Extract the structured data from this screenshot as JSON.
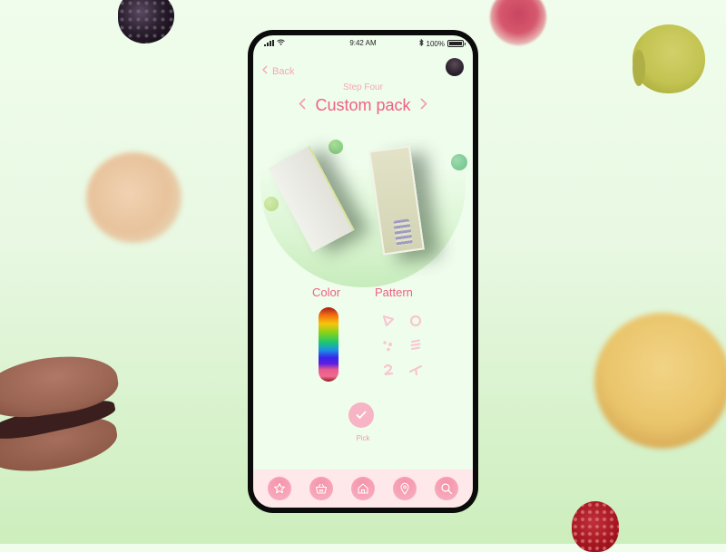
{
  "status_bar": {
    "time": "9:42 AM",
    "battery": "100%",
    "icons": [
      "signal-icon",
      "wifi-icon",
      "bluetooth-icon",
      "battery-icon"
    ]
  },
  "nav": {
    "back_label": "Back",
    "back_icon": "chevron-left-icon",
    "avatar": "user-avatar"
  },
  "header": {
    "step": "Step Four",
    "title": "Custom pack",
    "prev_icon": "chevron-left-icon",
    "next_icon": "chevron-right-icon"
  },
  "customizer": {
    "color_label": "Color",
    "pattern_label": "Pattern",
    "patterns": [
      "triangle-pattern",
      "circle-pattern",
      "dots-pattern",
      "lines-pattern",
      "squiggle-pattern",
      "wave-pattern"
    ],
    "pick_label": "Pick"
  },
  "tabbar": {
    "items": [
      {
        "icon": "star-icon",
        "name": "favorites"
      },
      {
        "icon": "basket-icon",
        "name": "basket"
      },
      {
        "icon": "home-icon",
        "name": "home"
      },
      {
        "icon": "location-pin-icon",
        "name": "location"
      },
      {
        "icon": "search-icon",
        "name": "search"
      }
    ]
  },
  "colors": {
    "accent": "#ee6383",
    "accent_light": "#f4a9b8",
    "screen_bg": "#effdec",
    "tabbar_bg": "#ffe8ea"
  }
}
